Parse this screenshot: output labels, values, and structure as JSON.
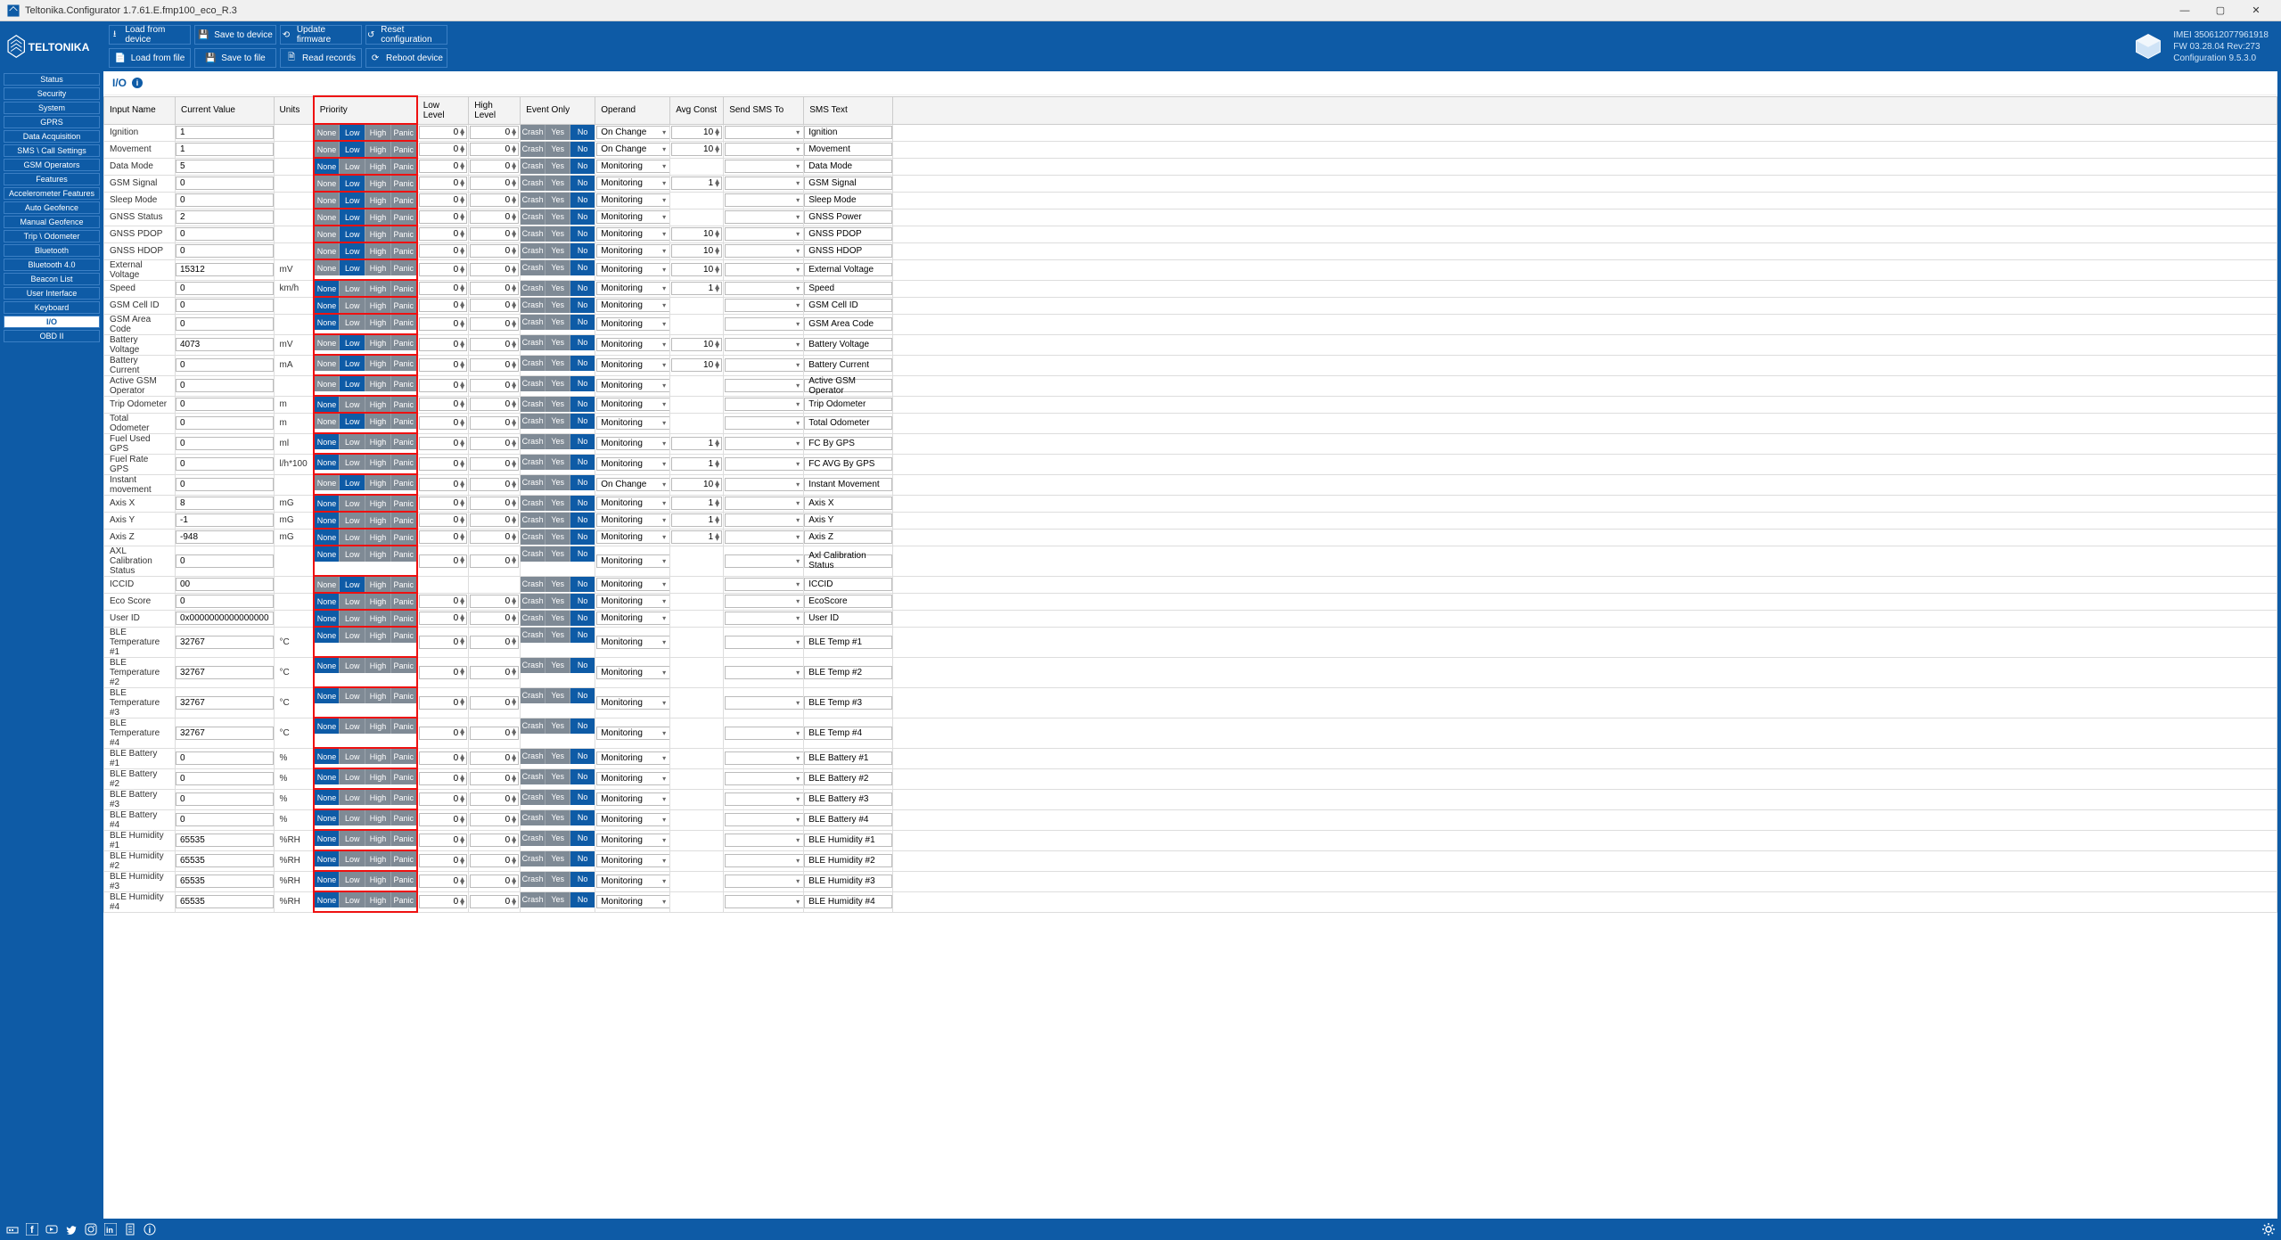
{
  "window": {
    "title": "Teltonika.Configurator 1.7.61.E.fmp100_eco_R.3"
  },
  "toolbar": {
    "row1": [
      "Load from device",
      "Save to device",
      "Update firmware",
      "Reset configuration"
    ],
    "row2": [
      "Load from file",
      "Save to file",
      "Read records",
      "Reboot device"
    ]
  },
  "device_info": {
    "imei": "IMEI 350612077961918",
    "fw": "FW 03.28.04 Rev:273",
    "config": "Configuration 9.5.3.0"
  },
  "sidebar": [
    "Status",
    "Security",
    "System",
    "GPRS",
    "Data Acquisition",
    "SMS \\ Call Settings",
    "GSM Operators",
    "Features",
    "Accelerometer Features",
    "Auto Geofence",
    "Manual Geofence",
    "Trip \\ Odometer",
    "Bluetooth",
    "Bluetooth 4.0",
    "Beacon List",
    "User Interface",
    "Keyboard",
    "I/O",
    "OBD II"
  ],
  "sidebar_active": 17,
  "page_title": "I/O",
  "columns": [
    "Input Name",
    "Current Value",
    "Units",
    "Priority",
    "Low Level",
    "High Level",
    "Event Only",
    "Operand",
    "Avg Const",
    "Send SMS To",
    "SMS Text"
  ],
  "priority_labels": [
    "None",
    "Low",
    "High",
    "Panic"
  ],
  "event_labels": [
    "Crash",
    "Yes",
    "No"
  ],
  "rows": [
    {
      "name": "Ignition",
      "cv": "1",
      "units": "",
      "pri": 1,
      "ll": "0",
      "hl": "0",
      "ev": 2,
      "op": "On Change",
      "avg": "10",
      "sms": "",
      "smstxt": "Ignition"
    },
    {
      "name": "Movement",
      "cv": "1",
      "units": "",
      "pri": 1,
      "ll": "0",
      "hl": "0",
      "ev": 2,
      "op": "On Change",
      "avg": "10",
      "sms": "",
      "smstxt": "Movement"
    },
    {
      "name": "Data Mode",
      "cv": "5",
      "units": "",
      "pri": 0,
      "ll": "0",
      "hl": "0",
      "ev": 2,
      "op": "Monitoring",
      "avg": "",
      "sms": "",
      "smstxt": "Data Mode"
    },
    {
      "name": "GSM Signal",
      "cv": "0",
      "units": "",
      "pri": 1,
      "ll": "0",
      "hl": "0",
      "ev": 2,
      "op": "Monitoring",
      "avg": "1",
      "sms": "",
      "smstxt": "GSM Signal"
    },
    {
      "name": "Sleep Mode",
      "cv": "0",
      "units": "",
      "pri": 1,
      "ll": "0",
      "hl": "0",
      "ev": 2,
      "op": "Monitoring",
      "avg": "",
      "sms": "",
      "smstxt": "Sleep Mode"
    },
    {
      "name": "GNSS Status",
      "cv": "2",
      "units": "",
      "pri": 1,
      "ll": "0",
      "hl": "0",
      "ev": 2,
      "op": "Monitoring",
      "avg": "",
      "sms": "",
      "smstxt": "GNSS Power"
    },
    {
      "name": "GNSS PDOP",
      "cv": "0",
      "units": "",
      "pri": 1,
      "ll": "0",
      "hl": "0",
      "ev": 2,
      "op": "Monitoring",
      "avg": "10",
      "sms": "",
      "smstxt": "GNSS PDOP"
    },
    {
      "name": "GNSS HDOP",
      "cv": "0",
      "units": "",
      "pri": 1,
      "ll": "0",
      "hl": "0",
      "ev": 2,
      "op": "Monitoring",
      "avg": "10",
      "sms": "",
      "smstxt": "GNSS HDOP"
    },
    {
      "name": "External Voltage",
      "cv": "15312",
      "units": "mV",
      "pri": 1,
      "ll": "0",
      "hl": "0",
      "ev": 2,
      "op": "Monitoring",
      "avg": "10",
      "sms": "",
      "smstxt": "External Voltage"
    },
    {
      "name": "Speed",
      "cv": "0",
      "units": "km/h",
      "pri": 0,
      "ll": "0",
      "hl": "0",
      "ev": 2,
      "op": "Monitoring",
      "avg": "1",
      "sms": "",
      "smstxt": "Speed"
    },
    {
      "name": "GSM Cell ID",
      "cv": "0",
      "units": "",
      "pri": 0,
      "ll": "0",
      "hl": "0",
      "ev": 2,
      "op": "Monitoring",
      "avg": "",
      "sms": "",
      "smstxt": "GSM Cell ID"
    },
    {
      "name": "GSM Area Code",
      "cv": "0",
      "units": "",
      "pri": 0,
      "ll": "0",
      "hl": "0",
      "ev": 2,
      "op": "Monitoring",
      "avg": "",
      "sms": "",
      "smstxt": "GSM Area Code"
    },
    {
      "name": "Battery Voltage",
      "cv": "4073",
      "units": "mV",
      "pri": 1,
      "ll": "0",
      "hl": "0",
      "ev": 2,
      "op": "Monitoring",
      "avg": "10",
      "sms": "",
      "smstxt": "Battery Voltage"
    },
    {
      "name": "Battery Current",
      "cv": "0",
      "units": "mA",
      "pri": 1,
      "ll": "0",
      "hl": "0",
      "ev": 2,
      "op": "Monitoring",
      "avg": "10",
      "sms": "",
      "smstxt": "Battery Current"
    },
    {
      "name": "Active GSM Operator",
      "cv": "0",
      "units": "",
      "pri": 1,
      "ll": "0",
      "hl": "0",
      "ev": 2,
      "op": "Monitoring",
      "avg": "",
      "sms": "",
      "smstxt": "Active GSM Operator"
    },
    {
      "name": "Trip Odometer",
      "cv": "0",
      "units": "m",
      "pri": 0,
      "ll": "0",
      "hl": "0",
      "ev": 2,
      "op": "Monitoring",
      "avg": "",
      "sms": "",
      "smstxt": "Trip Odometer"
    },
    {
      "name": "Total Odometer",
      "cv": "0",
      "units": "m",
      "pri": 1,
      "ll": "0",
      "hl": "0",
      "ev": 2,
      "op": "Monitoring",
      "avg": "",
      "sms": "",
      "smstxt": "Total Odometer"
    },
    {
      "name": "Fuel Used GPS",
      "cv": "0",
      "units": "ml",
      "pri": 0,
      "ll": "0",
      "hl": "0",
      "ev": 2,
      "op": "Monitoring",
      "avg": "1",
      "sms": "",
      "smstxt": "FC By GPS"
    },
    {
      "name": "Fuel Rate GPS",
      "cv": "0",
      "units": "l/h*100",
      "pri": 0,
      "ll": "0",
      "hl": "0",
      "ev": 2,
      "op": "Monitoring",
      "avg": "1",
      "sms": "",
      "smstxt": "FC AVG By GPS"
    },
    {
      "name": "Instant movement",
      "cv": "0",
      "units": "",
      "pri": 1,
      "ll": "0",
      "hl": "0",
      "ev": 2,
      "op": "On Change",
      "avg": "10",
      "sms": "",
      "smstxt": "Instant Movement"
    },
    {
      "name": "Axis X",
      "cv": "8",
      "units": "mG",
      "pri": 0,
      "ll": "0",
      "hl": "0",
      "ev": 2,
      "op": "Monitoring",
      "avg": "1",
      "sms": "",
      "smstxt": "Axis X"
    },
    {
      "name": "Axis Y",
      "cv": "-1",
      "units": "mG",
      "pri": 0,
      "ll": "0",
      "hl": "0",
      "ev": 2,
      "op": "Monitoring",
      "avg": "1",
      "sms": "",
      "smstxt": "Axis Y"
    },
    {
      "name": "Axis Z",
      "cv": "-948",
      "units": "mG",
      "pri": 0,
      "ll": "0",
      "hl": "0",
      "ev": 2,
      "op": "Monitoring",
      "avg": "1",
      "sms": "",
      "smstxt": "Axis Z"
    },
    {
      "name": "AXL Calibration Status",
      "cv": "0",
      "units": "",
      "pri": 0,
      "ll": "0",
      "hl": "0",
      "ev": 2,
      "op": "Monitoring",
      "avg": "",
      "sms": "",
      "smstxt": "Axl Calibration Status"
    },
    {
      "name": "ICCID",
      "cv": "00",
      "units": "",
      "pri": 1,
      "ll": null,
      "hl": null,
      "ev": 2,
      "op": "Monitoring",
      "avg": "",
      "sms": "",
      "smstxt": "ICCID"
    },
    {
      "name": "Eco Score",
      "cv": "0",
      "units": "",
      "pri": 0,
      "ll": "0",
      "hl": "0",
      "ev": 2,
      "op": "Monitoring",
      "avg": "",
      "sms": "",
      "smstxt": "EcoScore"
    },
    {
      "name": "User ID",
      "cv": "0x0000000000000000",
      "units": "",
      "pri": 0,
      "ll": "0",
      "hl": "0",
      "ev": 2,
      "op": "Monitoring",
      "avg": "",
      "sms": "",
      "smstxt": "User ID"
    },
    {
      "name": "BLE Temperature #1",
      "cv": "32767",
      "units": "°C",
      "pri": 0,
      "ll": "0",
      "hl": "0",
      "ev": 2,
      "op": "Monitoring",
      "avg": "",
      "sms": "",
      "smstxt": "BLE Temp #1"
    },
    {
      "name": "BLE Temperature #2",
      "cv": "32767",
      "units": "°C",
      "pri": 0,
      "ll": "0",
      "hl": "0",
      "ev": 2,
      "op": "Monitoring",
      "avg": "",
      "sms": "",
      "smstxt": "BLE Temp #2"
    },
    {
      "name": "BLE Temperature #3",
      "cv": "32767",
      "units": "°C",
      "pri": 0,
      "ll": "0",
      "hl": "0",
      "ev": 2,
      "op": "Monitoring",
      "avg": "",
      "sms": "",
      "smstxt": "BLE Temp #3"
    },
    {
      "name": "BLE Temperature #4",
      "cv": "32767",
      "units": "°C",
      "pri": 0,
      "ll": "0",
      "hl": "0",
      "ev": 2,
      "op": "Monitoring",
      "avg": "",
      "sms": "",
      "smstxt": "BLE Temp #4"
    },
    {
      "name": "BLE Battery #1",
      "cv": "0",
      "units": "%",
      "pri": 0,
      "ll": "0",
      "hl": "0",
      "ev": 2,
      "op": "Monitoring",
      "avg": "",
      "sms": "",
      "smstxt": "BLE Battery #1"
    },
    {
      "name": "BLE Battery #2",
      "cv": "0",
      "units": "%",
      "pri": 0,
      "ll": "0",
      "hl": "0",
      "ev": 2,
      "op": "Monitoring",
      "avg": "",
      "sms": "",
      "smstxt": "BLE Battery #2"
    },
    {
      "name": "BLE Battery #3",
      "cv": "0",
      "units": "%",
      "pri": 0,
      "ll": "0",
      "hl": "0",
      "ev": 2,
      "op": "Monitoring",
      "avg": "",
      "sms": "",
      "smstxt": "BLE Battery #3"
    },
    {
      "name": "BLE Battery #4",
      "cv": "0",
      "units": "%",
      "pri": 0,
      "ll": "0",
      "hl": "0",
      "ev": 2,
      "op": "Monitoring",
      "avg": "",
      "sms": "",
      "smstxt": "BLE Battery #4"
    },
    {
      "name": "BLE Humidity #1",
      "cv": "65535",
      "units": "%RH",
      "pri": 0,
      "ll": "0",
      "hl": "0",
      "ev": 2,
      "op": "Monitoring",
      "avg": "",
      "sms": "",
      "smstxt": "BLE Humidity #1"
    },
    {
      "name": "BLE Humidity #2",
      "cv": "65535",
      "units": "%RH",
      "pri": 0,
      "ll": "0",
      "hl": "0",
      "ev": 2,
      "op": "Monitoring",
      "avg": "",
      "sms": "",
      "smstxt": "BLE Humidity #2"
    },
    {
      "name": "BLE Humidity #3",
      "cv": "65535",
      "units": "%RH",
      "pri": 0,
      "ll": "0",
      "hl": "0",
      "ev": 2,
      "op": "Monitoring",
      "avg": "",
      "sms": "",
      "smstxt": "BLE Humidity #3"
    },
    {
      "name": "BLE Humidity #4",
      "cv": "65535",
      "units": "%RH",
      "pri": 0,
      "ll": "0",
      "hl": "0",
      "ev": 2,
      "op": "Monitoring",
      "avg": "",
      "sms": "",
      "smstxt": "BLE Humidity #4"
    }
  ]
}
